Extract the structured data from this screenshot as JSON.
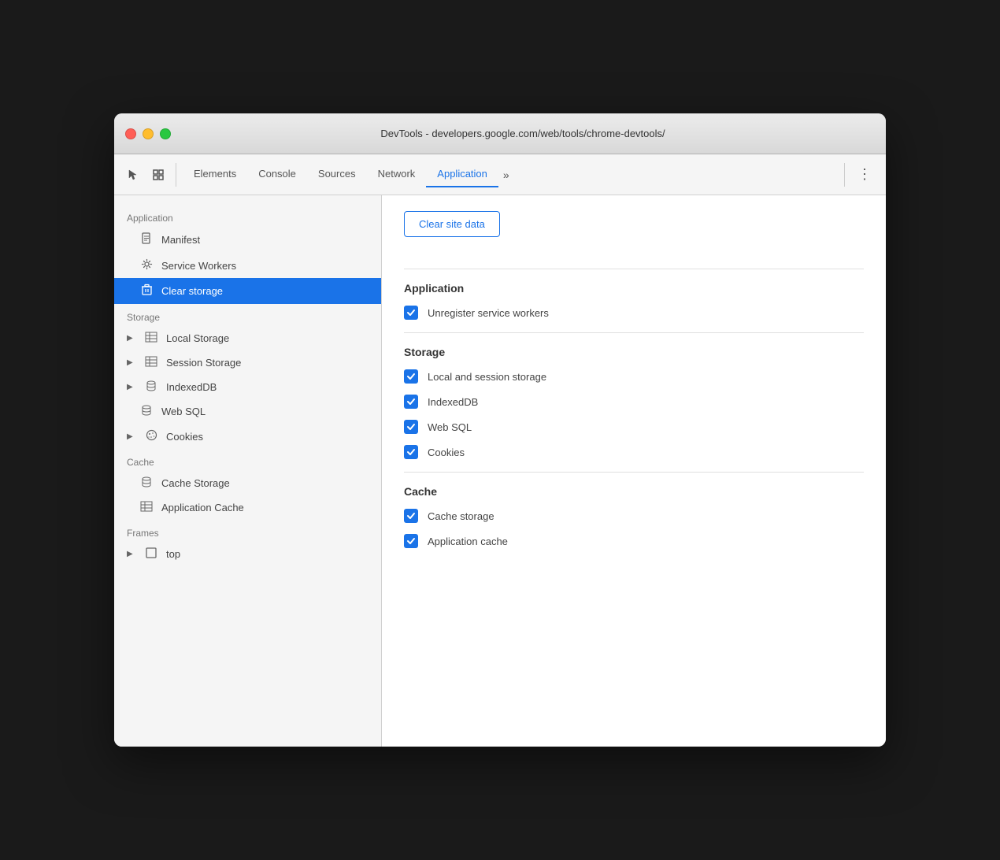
{
  "window": {
    "title": "DevTools - developers.google.com/web/tools/chrome-devtools/"
  },
  "toolbar": {
    "tabs": [
      {
        "id": "elements",
        "label": "Elements",
        "active": false
      },
      {
        "id": "console",
        "label": "Console",
        "active": false
      },
      {
        "id": "sources",
        "label": "Sources",
        "active": false
      },
      {
        "id": "network",
        "label": "Network",
        "active": false
      },
      {
        "id": "application",
        "label": "Application",
        "active": true
      }
    ],
    "more_label": "»",
    "menu_label": "⋮"
  },
  "sidebar": {
    "sections": [
      {
        "id": "application",
        "header": "Application",
        "items": [
          {
            "id": "manifest",
            "label": "Manifest",
            "icon": "manifest",
            "hasArrow": false,
            "active": false
          },
          {
            "id": "service-workers",
            "label": "Service Workers",
            "icon": "gear",
            "hasArrow": false,
            "active": false
          },
          {
            "id": "clear-storage",
            "label": "Clear storage",
            "icon": "trash",
            "hasArrow": false,
            "active": true
          }
        ]
      },
      {
        "id": "storage",
        "header": "Storage",
        "items": [
          {
            "id": "local-storage",
            "label": "Local Storage",
            "icon": "grid",
            "hasArrow": true,
            "active": false
          },
          {
            "id": "session-storage",
            "label": "Session Storage",
            "icon": "grid",
            "hasArrow": true,
            "active": false
          },
          {
            "id": "indexeddb",
            "label": "IndexedDB",
            "icon": "db",
            "hasArrow": true,
            "active": false
          },
          {
            "id": "web-sql",
            "label": "Web SQL",
            "icon": "db",
            "hasArrow": false,
            "active": false
          },
          {
            "id": "cookies",
            "label": "Cookies",
            "icon": "cookie",
            "hasArrow": true,
            "active": false
          }
        ]
      },
      {
        "id": "cache",
        "header": "Cache",
        "items": [
          {
            "id": "cache-storage",
            "label": "Cache Storage",
            "icon": "db",
            "hasArrow": false,
            "active": false
          },
          {
            "id": "application-cache",
            "label": "Application Cache",
            "icon": "grid",
            "hasArrow": false,
            "active": false
          }
        ]
      },
      {
        "id": "frames",
        "header": "Frames",
        "items": [
          {
            "id": "top",
            "label": "top",
            "icon": "frame",
            "hasArrow": true,
            "active": false
          }
        ]
      }
    ]
  },
  "content": {
    "clear_button_label": "Clear site data",
    "sections": [
      {
        "id": "application",
        "title": "Application",
        "items": [
          {
            "id": "unregister-sw",
            "label": "Unregister service workers",
            "checked": true
          }
        ]
      },
      {
        "id": "storage",
        "title": "Storage",
        "items": [
          {
            "id": "local-session-storage",
            "label": "Local and session storage",
            "checked": true
          },
          {
            "id": "indexeddb",
            "label": "IndexedDB",
            "checked": true
          },
          {
            "id": "web-sql",
            "label": "Web SQL",
            "checked": true
          },
          {
            "id": "cookies",
            "label": "Cookies",
            "checked": true
          }
        ]
      },
      {
        "id": "cache",
        "title": "Cache",
        "items": [
          {
            "id": "cache-storage",
            "label": "Cache storage",
            "checked": true
          },
          {
            "id": "application-cache",
            "label": "Application cache",
            "checked": true
          }
        ]
      }
    ]
  }
}
